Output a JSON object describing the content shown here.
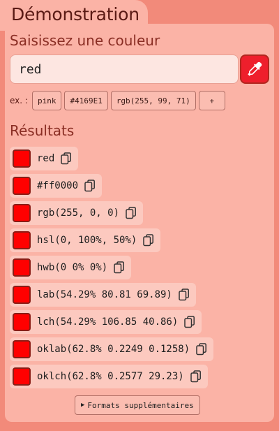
{
  "header": {
    "title": "Démonstration"
  },
  "input_section": {
    "title": "Saisissez une couleur",
    "value": "red",
    "picker_icon": "eyedropper-icon"
  },
  "examples": {
    "label": "ex. :",
    "chips": [
      "pink",
      "#4169E1",
      "rgb(255, 99, 71)",
      "+"
    ]
  },
  "results_section": {
    "title": "Résultats",
    "swatch_color": "#ff0000",
    "copy_icon": "copy-icon",
    "items": [
      "red",
      "#ff0000",
      "rgb(255, 0, 0)",
      "hsl(0, 100%, 50%)",
      "hwb(0 0% 0%)",
      "lab(54.29% 80.81 69.89)",
      "lch(54.29% 106.85 40.86)",
      "oklab(62.8% 0.2249 0.1258)",
      "oklch(62.8% 0.2577 29.23)"
    ]
  },
  "more_formats": {
    "arrow": "▶",
    "label": "Formats supplémentaires"
  }
}
